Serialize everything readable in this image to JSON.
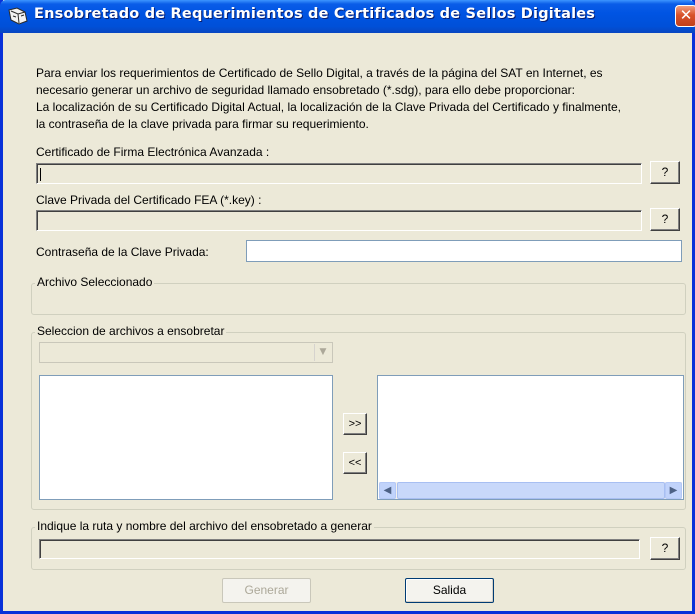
{
  "window": {
    "title": "Ensobretado de Requerimientos de Certificados de Sellos Digitales",
    "close_label": "✕"
  },
  "intro": [
    "Para enviar  los requerimientos  de Certificado de Sello  Digital, a través de la página del SAT en  Internet, es",
    "necesario generar un archivo de seguridad llamado ensobretado (*.sdg),  para ello debe proporcionar:",
    "La localización de su Certificado Digital Actual, la localización de la Clave Privada  del Certificado y finalmente,",
    "la contraseña de la clave privada para firmar su requerimiento."
  ],
  "fields": {
    "fea_label": "Certificado de Firma Electrónica Avanzada :",
    "key_label": "Clave Privada del Certificado FEA (*.key) :",
    "password_label": "Contraseña de la Clave Privada:",
    "browse_label": "?"
  },
  "archivo_seleccionado": {
    "legend": "Archivo Seleccionado"
  },
  "seleccion": {
    "legend": "Seleccion de archivos a ensobretar",
    "add_label": ">>",
    "remove_label": "<<"
  },
  "output": {
    "legend": "Indique la ruta y nombre del archivo del ensobretado a generar",
    "browse_label": "?"
  },
  "buttons": {
    "generar": "Generar",
    "salida": "Salida"
  },
  "colors": {
    "title_bar": "#0054e3",
    "window_bg": "#ece9d8",
    "close_button": "#d8522a"
  }
}
